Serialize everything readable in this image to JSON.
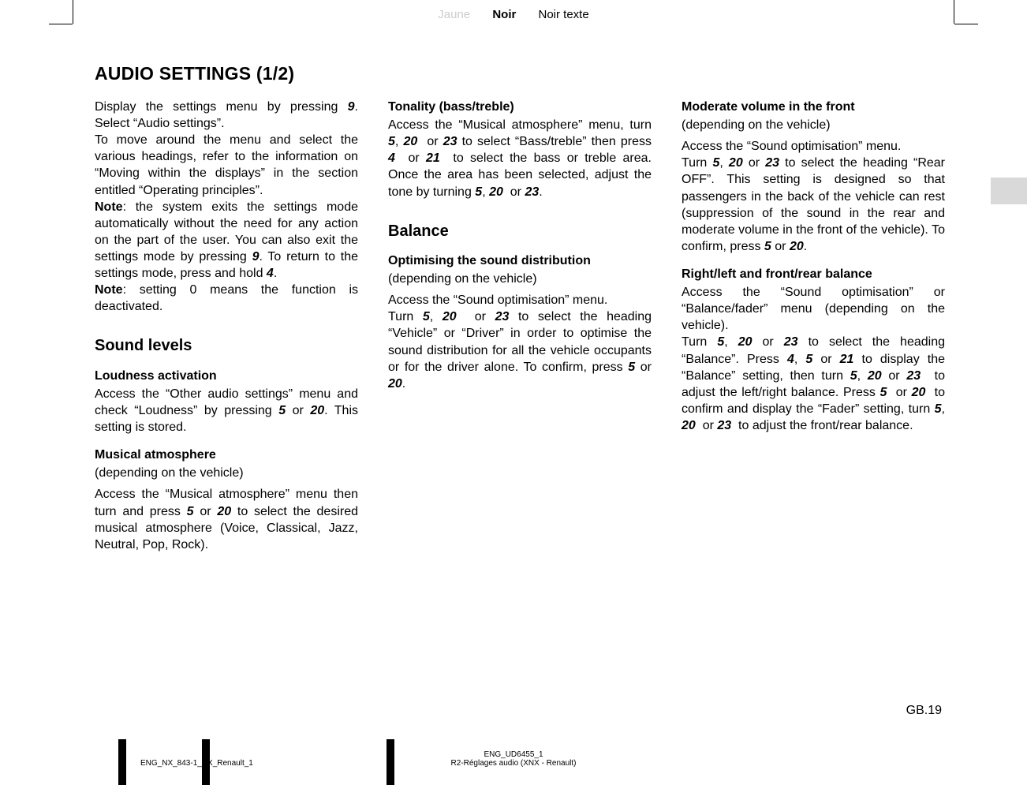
{
  "header": {
    "jaune": "Jaune",
    "noir": "Noir",
    "noir_texte": "Noir texte"
  },
  "title": "AUDIO SETTINGS (1/2)",
  "col1": {
    "p1": "Display the settings menu by pressing 9. Select “Audio settings”.",
    "p2": "To move around the menu and select the various headings, refer to the information on “Moving within the displays” in the section entitled “Operating principles”.",
    "p3a": "Note",
    "p3b": ": the system exits the settings mode automatically without the need for any action on the part of the user. You can also exit the settings mode by pressing 9. To return to the settings mode, press and hold 4.",
    "p4a": "Note",
    "p4b": ": setting 0 means the function is deactivated.",
    "h2": "Sound levels",
    "h3a": "Loudness activation",
    "p5": "Access the “Other audio settings” menu and check “Loudness” by pressing 5 or 20. This setting is stored.",
    "h3b": "Musical atmosphere",
    "sub": "(depending on the vehicle)",
    "p6": "Access the “Musical atmosphere” menu then turn and press  5 or  20 to select the desired musical atmosphere (Voice, Classical, Jazz, Neutral, Pop, Rock)."
  },
  "col2": {
    "h3a": "Tonality (bass/treble)",
    "p1": "Access the “Musical atmosphere” menu, turn 5, 20  or 23 to select “Bass/treble” then press 4  or 21  to select the bass or treble area. Once the area has been selected, adjust the tone by turning 5, 20  or 23.",
    "h2": "Balance",
    "h3b": "Optimising the sound distribution",
    "sub": "(depending on the vehicle)",
    "p2": "Access the “Sound optimisation” menu.",
    "p3": "Turn 5, 20  or 23 to select the heading “Vehicle” or “Driver” in order to optimise the sound distribution for all the vehicle occupants or for the driver alone. To confirm, press 5 or 20."
  },
  "col3": {
    "h3a": "Moderate volume in the front",
    "sub1": "(depending on the vehicle)",
    "p1": "Access the “Sound optimisation” menu.",
    "p2": "Turn 5, 20 or 23 to select the heading “Rear OFF”. This setting is designed so that passengers in the back of the vehicle can rest (suppression of the sound in the rear and moderate volume in the front of the vehicle). To confirm, press 5 or 20.",
    "h3b": "Right/left and front/rear balance",
    "p3": "Access the “Sound optimisation” or “Balance/fader” menu (depending on the vehicle).",
    "p4": "Turn 5, 20 or 23 to select the heading “Balance”. Press 4, 5 or 21 to display the “Balance” setting, then turn 5, 20 or 23  to adjust the left/right balance. Press 5  or 20  to confirm and display the “Fader” setting, turn 5, 20  or 23  to adjust the front/rear balance."
  },
  "footer": {
    "page": "GB.19",
    "code1": "ENG_NX_843-1_NX_Renault_1",
    "code2a": "ENG_UD6455_1",
    "code2b": "R2-Réglages audio (XNX - Renault)"
  }
}
